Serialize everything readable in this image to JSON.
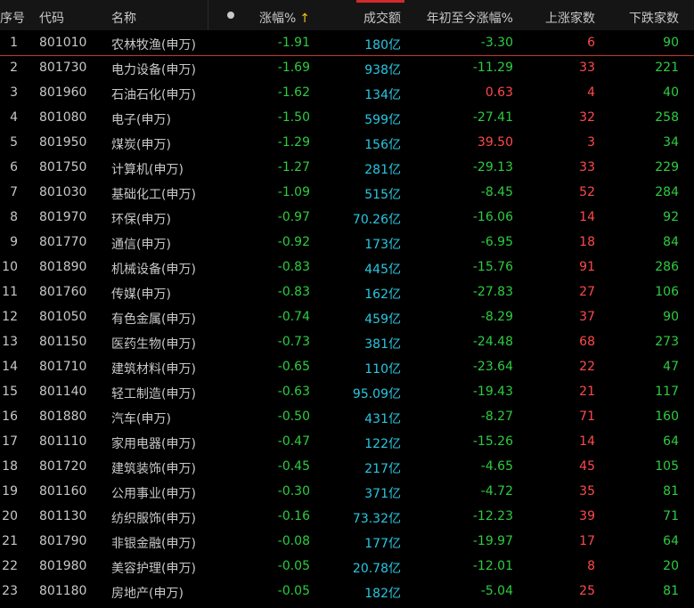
{
  "header": {
    "seq": "序号",
    "code": "代码",
    "name": "名称",
    "change": "涨幅%",
    "change_sort_icon": "arrow-up-icon",
    "volume": "成交额",
    "ytd": "年初至今涨幅%",
    "up_count": "上涨家数",
    "down_count": "下跌家数"
  },
  "colors": {
    "green": "#2ecc40",
    "red": "#ff4a4a",
    "cyan": "#29c7e0",
    "accent": "#d02a2a",
    "sort_arrow": "#f1c40f"
  },
  "rows": [
    {
      "seq": "1",
      "code": "801010",
      "name": "农林牧渔(申万)",
      "change": "-1.91",
      "volume": "180亿",
      "ytd": "-3.30",
      "ytd_up": false,
      "up": "6",
      "down": "90"
    },
    {
      "seq": "2",
      "code": "801730",
      "name": "电力设备(申万)",
      "change": "-1.69",
      "volume": "938亿",
      "ytd": "-11.29",
      "ytd_up": false,
      "up": "33",
      "down": "221"
    },
    {
      "seq": "3",
      "code": "801960",
      "name": "石油石化(申万)",
      "change": "-1.62",
      "volume": "134亿",
      "ytd": "0.63",
      "ytd_up": true,
      "up": "4",
      "down": "40"
    },
    {
      "seq": "4",
      "code": "801080",
      "name": "电子(申万)",
      "change": "-1.50",
      "volume": "599亿",
      "ytd": "-27.41",
      "ytd_up": false,
      "up": "32",
      "down": "258"
    },
    {
      "seq": "5",
      "code": "801950",
      "name": "煤炭(申万)",
      "change": "-1.29",
      "volume": "156亿",
      "ytd": "39.50",
      "ytd_up": true,
      "up": "3",
      "down": "34"
    },
    {
      "seq": "6",
      "code": "801750",
      "name": "计算机(申万)",
      "change": "-1.27",
      "volume": "281亿",
      "ytd": "-29.13",
      "ytd_up": false,
      "up": "33",
      "down": "229"
    },
    {
      "seq": "7",
      "code": "801030",
      "name": "基础化工(申万)",
      "change": "-1.09",
      "volume": "515亿",
      "ytd": "-8.45",
      "ytd_up": false,
      "up": "52",
      "down": "284"
    },
    {
      "seq": "8",
      "code": "801970",
      "name": "环保(申万)",
      "change": "-0.97",
      "volume": "70.26亿",
      "ytd": "-16.06",
      "ytd_up": false,
      "up": "14",
      "down": "92"
    },
    {
      "seq": "9",
      "code": "801770",
      "name": "通信(申万)",
      "change": "-0.92",
      "volume": "173亿",
      "ytd": "-6.95",
      "ytd_up": false,
      "up": "18",
      "down": "84"
    },
    {
      "seq": "10",
      "code": "801890",
      "name": "机械设备(申万)",
      "change": "-0.83",
      "volume": "445亿",
      "ytd": "-15.76",
      "ytd_up": false,
      "up": "91",
      "down": "286"
    },
    {
      "seq": "11",
      "code": "801760",
      "name": "传媒(申万)",
      "change": "-0.83",
      "volume": "162亿",
      "ytd": "-27.83",
      "ytd_up": false,
      "up": "27",
      "down": "106"
    },
    {
      "seq": "12",
      "code": "801050",
      "name": "有色金属(申万)",
      "change": "-0.74",
      "volume": "459亿",
      "ytd": "-8.29",
      "ytd_up": false,
      "up": "37",
      "down": "90"
    },
    {
      "seq": "13",
      "code": "801150",
      "name": "医药生物(申万)",
      "change": "-0.73",
      "volume": "381亿",
      "ytd": "-24.48",
      "ytd_up": false,
      "up": "68",
      "down": "273"
    },
    {
      "seq": "14",
      "code": "801710",
      "name": "建筑材料(申万)",
      "change": "-0.65",
      "volume": "110亿",
      "ytd": "-23.64",
      "ytd_up": false,
      "up": "22",
      "down": "47"
    },
    {
      "seq": "15",
      "code": "801140",
      "name": "轻工制造(申万)",
      "change": "-0.63",
      "volume": "95.09亿",
      "ytd": "-19.43",
      "ytd_up": false,
      "up": "21",
      "down": "117"
    },
    {
      "seq": "16",
      "code": "801880",
      "name": "汽车(申万)",
      "change": "-0.50",
      "volume": "431亿",
      "ytd": "-8.27",
      "ytd_up": false,
      "up": "71",
      "down": "160"
    },
    {
      "seq": "17",
      "code": "801110",
      "name": "家用电器(申万)",
      "change": "-0.47",
      "volume": "122亿",
      "ytd": "-15.26",
      "ytd_up": false,
      "up": "14",
      "down": "64"
    },
    {
      "seq": "18",
      "code": "801720",
      "name": "建筑装饰(申万)",
      "change": "-0.45",
      "volume": "217亿",
      "ytd": "-4.65",
      "ytd_up": false,
      "up": "45",
      "down": "105"
    },
    {
      "seq": "19",
      "code": "801160",
      "name": "公用事业(申万)",
      "change": "-0.30",
      "volume": "371亿",
      "ytd": "-4.72",
      "ytd_up": false,
      "up": "35",
      "down": "81"
    },
    {
      "seq": "20",
      "code": "801130",
      "name": "纺织服饰(申万)",
      "change": "-0.16",
      "volume": "73.32亿",
      "ytd": "-12.23",
      "ytd_up": false,
      "up": "39",
      "down": "71"
    },
    {
      "seq": "21",
      "code": "801790",
      "name": "非银金融(申万)",
      "change": "-0.08",
      "volume": "177亿",
      "ytd": "-19.97",
      "ytd_up": false,
      "up": "17",
      "down": "64"
    },
    {
      "seq": "22",
      "code": "801980",
      "name": "美容护理(申万)",
      "change": "-0.05",
      "volume": "20.78亿",
      "ytd": "-12.01",
      "ytd_up": false,
      "up": "8",
      "down": "20"
    },
    {
      "seq": "23",
      "code": "801180",
      "name": "房地产(申万)",
      "change": "-0.05",
      "volume": "182亿",
      "ytd": "-5.04",
      "ytd_up": false,
      "up": "25",
      "down": "81"
    }
  ]
}
